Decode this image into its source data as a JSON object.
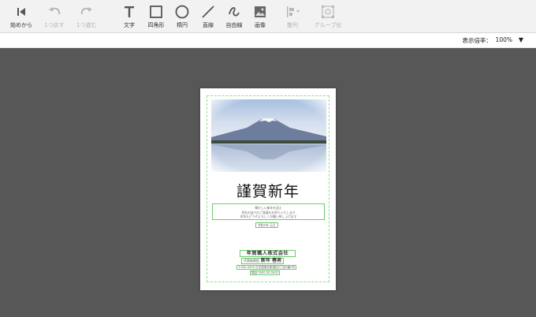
{
  "toolbar": {
    "tools": [
      {
        "label": "始めから",
        "icon": "skip-to-start-icon",
        "enabled": true
      },
      {
        "label": "1つ戻す",
        "icon": "undo-icon",
        "enabled": false
      },
      {
        "label": "1つ進む",
        "icon": "redo-icon",
        "enabled": false
      },
      {
        "label": "文字",
        "icon": "text-icon",
        "enabled": true
      },
      {
        "label": "四角形",
        "icon": "rectangle-icon",
        "enabled": true
      },
      {
        "label": "楕円",
        "icon": "ellipse-icon",
        "enabled": true
      },
      {
        "label": "直線",
        "icon": "line-icon",
        "enabled": true
      },
      {
        "label": "自由線",
        "icon": "freehand-icon",
        "enabled": true
      },
      {
        "label": "画像",
        "icon": "image-icon",
        "enabled": true
      },
      {
        "label": "整列",
        "icon": "align-icon",
        "enabled": false
      },
      {
        "label": "グループ化",
        "icon": "group-icon",
        "enabled": false
      }
    ]
  },
  "zoom": {
    "label": "表示倍率：",
    "value": "100%"
  },
  "card": {
    "greeting": "謹賀新年",
    "message_lines": [
      "輝かしい新年を迎え",
      "貴社の益々のご発展をお祈りいたします",
      "本年もどうぞよろしくお願い申し上げます"
    ],
    "date": "令和5年 元旦",
    "company": "年賀職人株式会社",
    "title": "代表取締役",
    "name": "新年 春男",
    "address": "〒000-0000 日本国東京都港区0丁目0番0号",
    "tel": "電話 0000-00-0000"
  },
  "colors": {
    "toolbar_bg": "#f2f2f2",
    "canvas_bg": "#575757",
    "guide_green": "#8ee08e",
    "icon_dark": "#555555",
    "icon_disabled": "#b8b8b8"
  }
}
